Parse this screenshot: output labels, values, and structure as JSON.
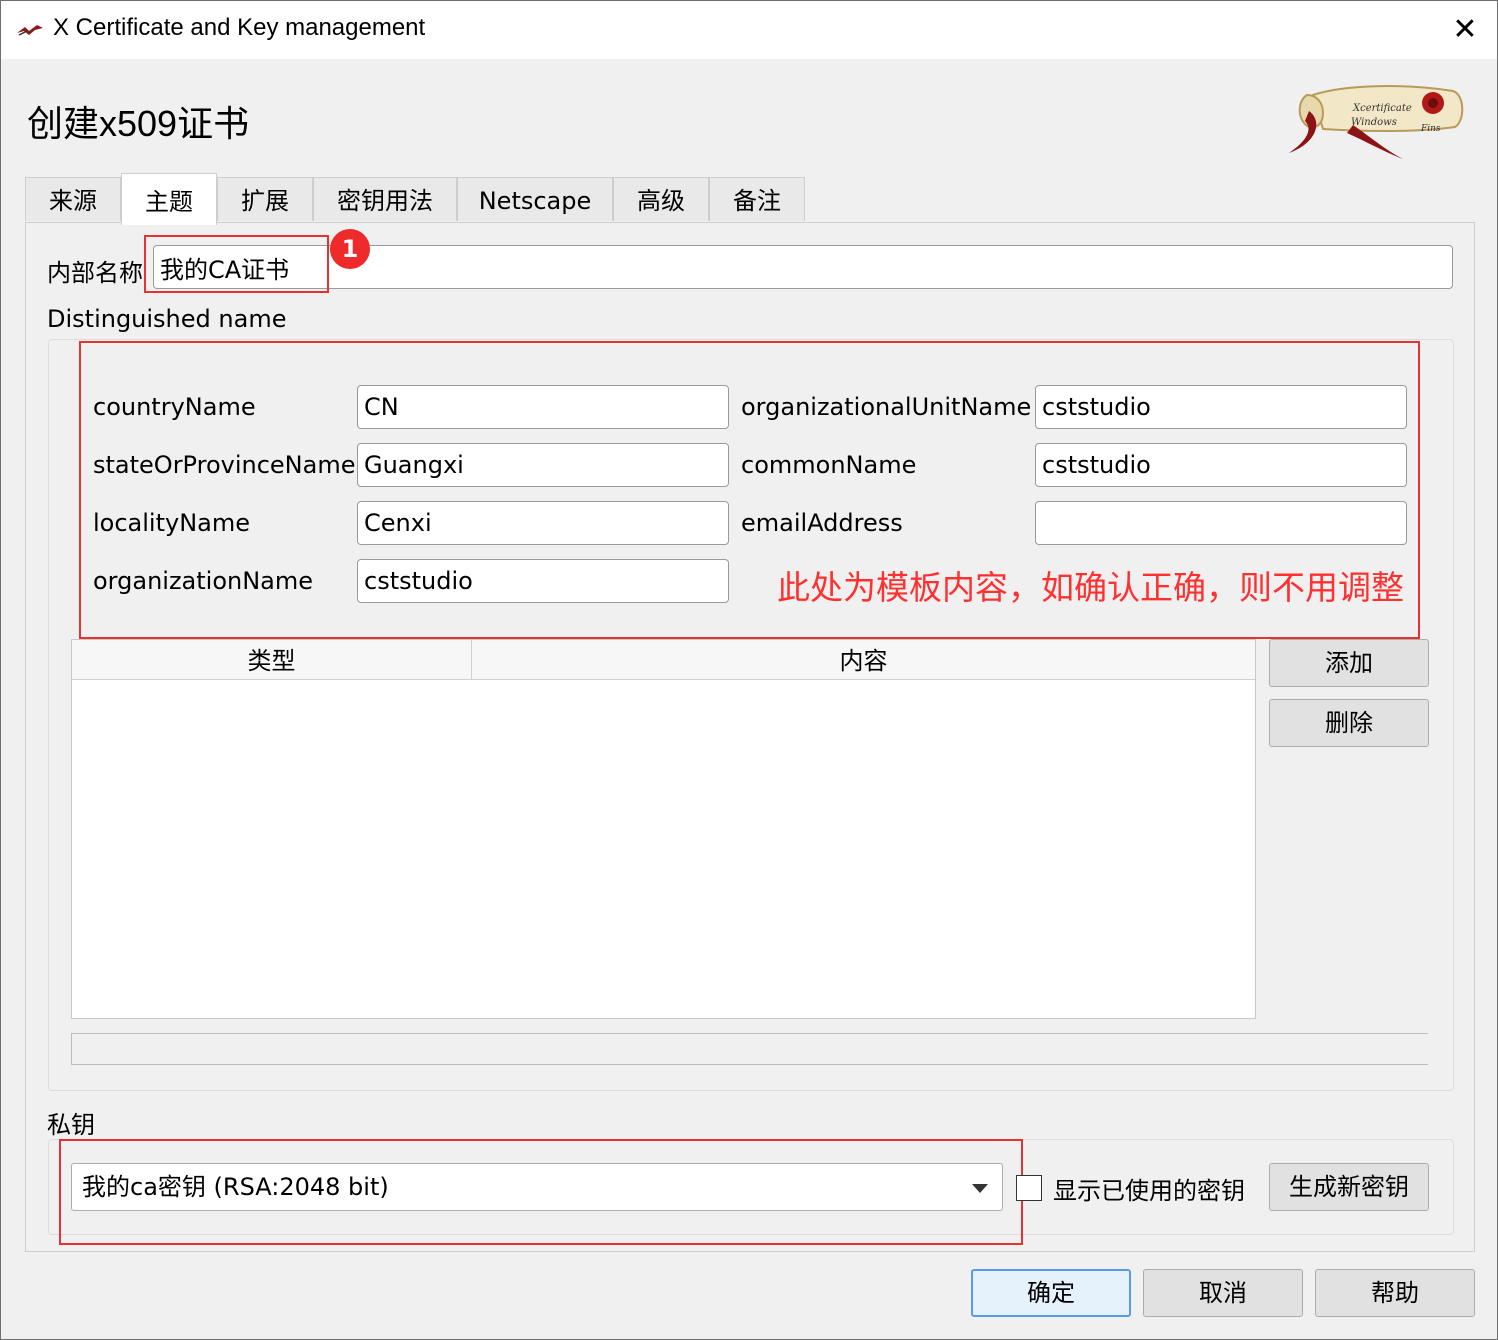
{
  "window": {
    "title": "X Certificate and Key management",
    "close_glyph": "✕"
  },
  "heading": "创建x509证书",
  "logo_text": {
    "line1": "Xcertificate",
    "line2": "Windows",
    "line3": "Fins"
  },
  "tabs": [
    {
      "label": "来源"
    },
    {
      "label": "主题",
      "active": true
    },
    {
      "label": "扩展"
    },
    {
      "label": "密钥用法"
    },
    {
      "label": "Netscape"
    },
    {
      "label": "高级"
    },
    {
      "label": "备注"
    }
  ],
  "internal_name": {
    "label": "内部名称",
    "value": "我的CA证书"
  },
  "badge": "1",
  "dn": {
    "title": "Distinguished name",
    "left": [
      {
        "label": "countryName",
        "value": "CN"
      },
      {
        "label": "stateOrProvinceName",
        "value": "Guangxi"
      },
      {
        "label": "localityName",
        "value": "Cenxi"
      },
      {
        "label": "organizationName",
        "value": "cststudio"
      }
    ],
    "right": [
      {
        "label": "organizationalUnitName",
        "value": "cststudio"
      },
      {
        "label": "commonName",
        "value": "cststudio"
      },
      {
        "label": "emailAddress",
        "value": ""
      }
    ]
  },
  "annotation": "此处为模板内容，如确认正确，则不用调整",
  "table": {
    "columns": [
      "类型",
      "内容"
    ],
    "rows": []
  },
  "table_buttons": {
    "add": "添加",
    "delete": "删除"
  },
  "private_key": {
    "title": "私钥",
    "selected": "我的ca密钥 (RSA:2048 bit)",
    "show_used_label": "显示已使用的密钥",
    "show_used_checked": false,
    "generate_label": "生成新密钥"
  },
  "footer": {
    "ok": "确定",
    "cancel": "取消",
    "help": "帮助"
  },
  "colors": {
    "annotation_red": "#ff3030",
    "highlight_box": "#e53333",
    "primary_border": "#5a9ae6"
  }
}
